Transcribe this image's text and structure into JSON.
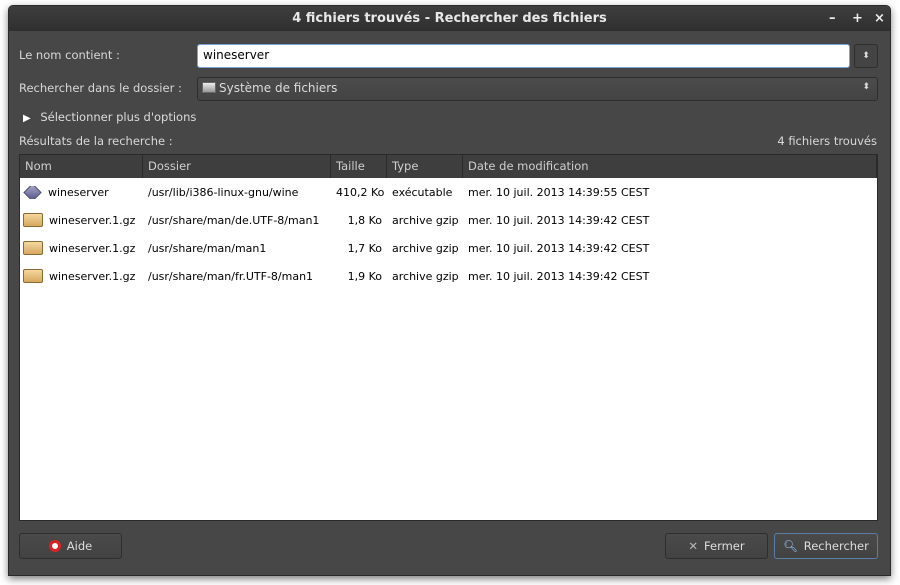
{
  "window": {
    "title": "4 fichiers trouvés - Rechercher des fichiers",
    "minimize": "–",
    "maximize": "+",
    "close": "×"
  },
  "form": {
    "name_label": "Le nom contient :",
    "name_value": "wineserver",
    "folder_label": "Rechercher dans le dossier :",
    "folder_value": "Système de fichiers",
    "more_options": "Sélectionner plus d'options",
    "results_label": "Résultats de la recherche :",
    "results_count": "4 fichiers trouvés"
  },
  "columns": [
    "Nom",
    "Dossier",
    "Taille",
    "Type",
    "Date de modification"
  ],
  "rows": [
    {
      "icon": "executable",
      "name": "wineserver",
      "folder": "/usr/lib/i386-linux-gnu/wine",
      "size": "410,2 Ko",
      "type": "exécutable",
      "date": "mer. 10 juil. 2013 14:39:55 CEST"
    },
    {
      "icon": "archive",
      "name": "wineserver.1.gz",
      "folder": "/usr/share/man/de.UTF-8/man1",
      "size": "1,8 Ko",
      "type": "archive gzip",
      "date": "mer. 10 juil. 2013 14:39:42 CEST"
    },
    {
      "icon": "archive",
      "name": "wineserver.1.gz",
      "folder": "/usr/share/man/man1",
      "size": "1,7 Ko",
      "type": "archive gzip",
      "date": "mer. 10 juil. 2013 14:39:42 CEST"
    },
    {
      "icon": "archive",
      "name": "wineserver.1.gz",
      "folder": "/usr/share/man/fr.UTF-8/man1",
      "size": "1,9 Ko",
      "type": "archive gzip",
      "date": "mer. 10 juil. 2013 14:39:42 CEST"
    }
  ],
  "buttons": {
    "help": "Aide",
    "close": "Fermer",
    "search": "Rechercher"
  }
}
